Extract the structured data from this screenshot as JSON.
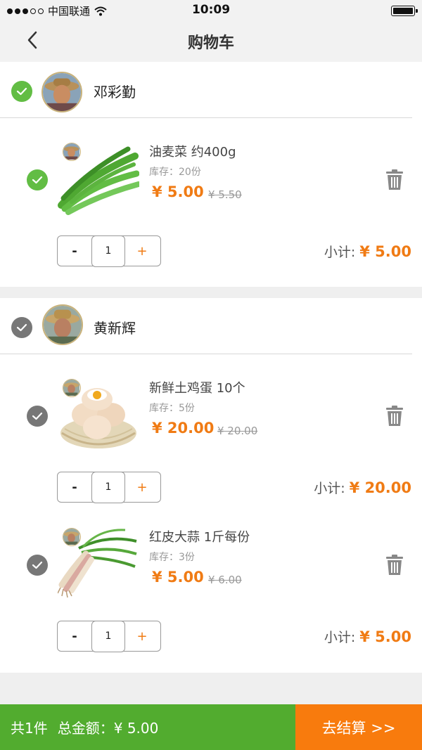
{
  "status_bar": {
    "carrier": "中国联通",
    "time": "10:09",
    "signal_icon": "signal-dots-icon",
    "wifi_icon": "wifi-icon",
    "battery_icon": "battery-icon"
  },
  "nav": {
    "title": "购物车",
    "back_icon": "chevron-left-icon"
  },
  "colors": {
    "accent_orange": "#f07b14",
    "check_green": "#62bd44",
    "footer_green": "#52ac2f",
    "checkout_orange": "#f87b0d"
  },
  "groups": [
    {
      "farmer_name": "邓彩勤",
      "checked": true,
      "items": [
        {
          "name": "油麦菜 约400g",
          "stock": "库存：20份",
          "price": "¥ 5.00",
          "original_price": "¥ 5.50",
          "quantity": "1",
          "subtotal_label": "小计:",
          "subtotal": "¥ 5.00",
          "checked": true
        }
      ]
    },
    {
      "farmer_name": "黄新辉",
      "checked": false,
      "items": [
        {
          "name": "新鲜土鸡蛋 10个",
          "stock": "库存：5份",
          "price": "¥ 20.00",
          "original_price": "¥ 20.00",
          "quantity": "1",
          "subtotal_label": "小计:",
          "subtotal": "¥ 20.00",
          "checked": false
        },
        {
          "name": "红皮大蒜 1斤每份",
          "stock": "库存：3份",
          "price": "¥ 5.00",
          "original_price": "¥ 6.00",
          "quantity": "1",
          "subtotal_label": "小计:",
          "subtotal": "¥ 5.00",
          "checked": false
        }
      ]
    }
  ],
  "stepper": {
    "minus": "-",
    "plus": "+"
  },
  "footer": {
    "count": "共1件",
    "total_label": "总金额：",
    "total": "¥ 5.00",
    "checkout": "去结算 >>"
  }
}
